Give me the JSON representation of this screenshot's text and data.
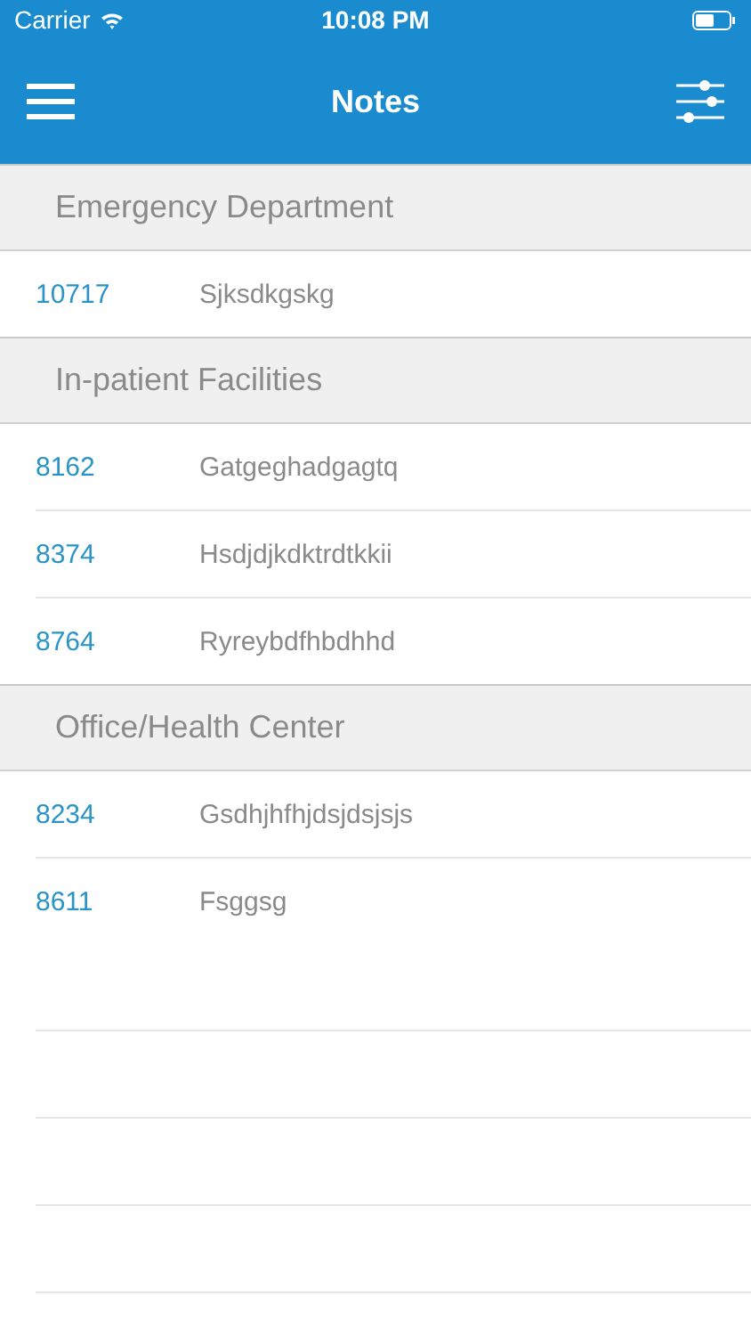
{
  "status_bar": {
    "carrier": "Carrier",
    "time": "10:08 PM"
  },
  "nav": {
    "title": "Notes"
  },
  "sections": [
    {
      "title": "Emergency Department",
      "rows": [
        {
          "id": "10717",
          "text": "Sjksdkgskg"
        }
      ]
    },
    {
      "title": "In-patient Facilities",
      "rows": [
        {
          "id": "8162",
          "text": "Gatgeghadgagtq"
        },
        {
          "id": "8374",
          "text": "Hsdjdjkdktrdtkkii"
        },
        {
          "id": "8764",
          "text": "Ryreybdfhbdhhd"
        }
      ]
    },
    {
      "title": "Office/Health Center",
      "rows": [
        {
          "id": "8234",
          "text": "Gsdhjhfhjdsjdsjsjs"
        },
        {
          "id": "8611",
          "text": "Fsggsg"
        }
      ]
    }
  ]
}
